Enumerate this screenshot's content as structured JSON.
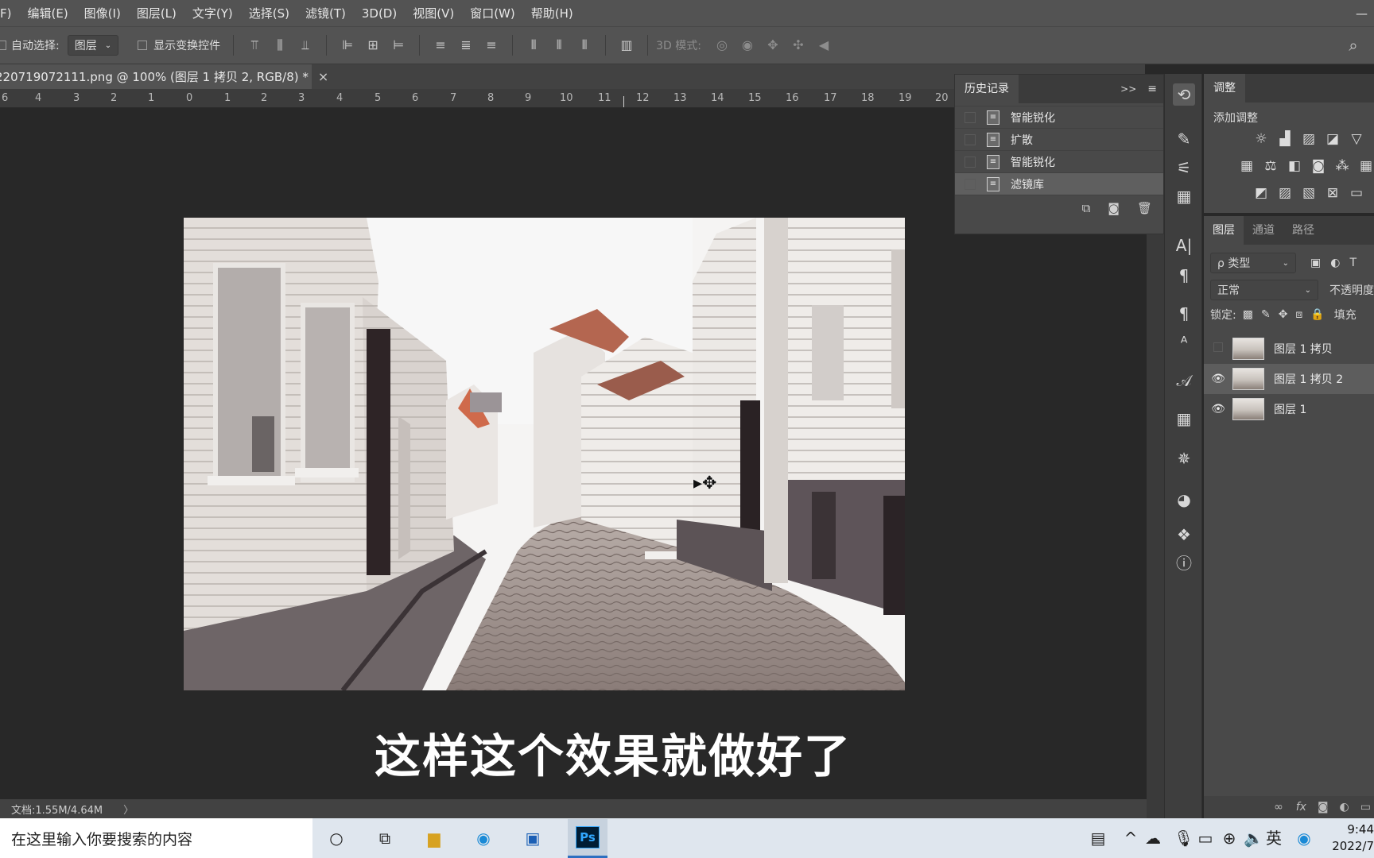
{
  "menubar": {
    "items": [
      "F)",
      "编辑(E)",
      "图像(I)",
      "图层(L)",
      "文字(Y)",
      "选择(S)",
      "滤镜(T)",
      "3D(D)",
      "视图(V)",
      "窗口(W)",
      "帮助(H)"
    ],
    "minimize": "—"
  },
  "options": {
    "auto_select_label": "自动选择:",
    "auto_select_value": "图层",
    "show_transform_label": "显示变换控件",
    "mode_3d_label": "3D 模式:"
  },
  "document": {
    "tab_title": "220719072111.png @ 100% (图层 1 拷贝 2, RGB/8) *",
    "close": "×",
    "ruler_ticks": [
      "6",
      "4",
      "3",
      "2",
      "1",
      "0",
      "1",
      "2",
      "3",
      "4",
      "5",
      "6",
      "7",
      "8",
      "9",
      "10",
      "11",
      "12",
      "13",
      "14",
      "15",
      "16",
      "17",
      "18",
      "19",
      "20"
    ],
    "subtitle": "这样这个效果就做好了",
    "status": "文档:1.55M/4.64M",
    "status_arrow": "〉"
  },
  "history": {
    "title": "历史记录",
    "expand": ">>",
    "menu": "≡",
    "items": [
      {
        "label": "智能锐化",
        "selected": false
      },
      {
        "label": "扩散",
        "selected": false
      },
      {
        "label": "智能锐化",
        "selected": false
      },
      {
        "label": "滤镜库",
        "selected": true
      }
    ]
  },
  "adjustments": {
    "title": "调整",
    "add_label": "添加调整"
  },
  "layers": {
    "tabs": [
      "图层",
      "通道",
      "路径"
    ],
    "filter_label": "ρ 类型",
    "blend_mode": "正常",
    "opacity_label": "不透明度",
    "lock_label": "锁定:",
    "fill_label": "填充",
    "items": [
      {
        "name": "图层 1 拷贝",
        "visible": false,
        "selected": false
      },
      {
        "name": "图层 1 拷贝 2",
        "visible": true,
        "selected": true
      },
      {
        "name": "图层 1",
        "visible": true,
        "selected": false
      }
    ],
    "footer": [
      "∞",
      "fx"
    ]
  },
  "taskbar": {
    "search_placeholder": "在这里输入你要搜索的内容",
    "time": "9:44",
    "date": "2022/7"
  }
}
